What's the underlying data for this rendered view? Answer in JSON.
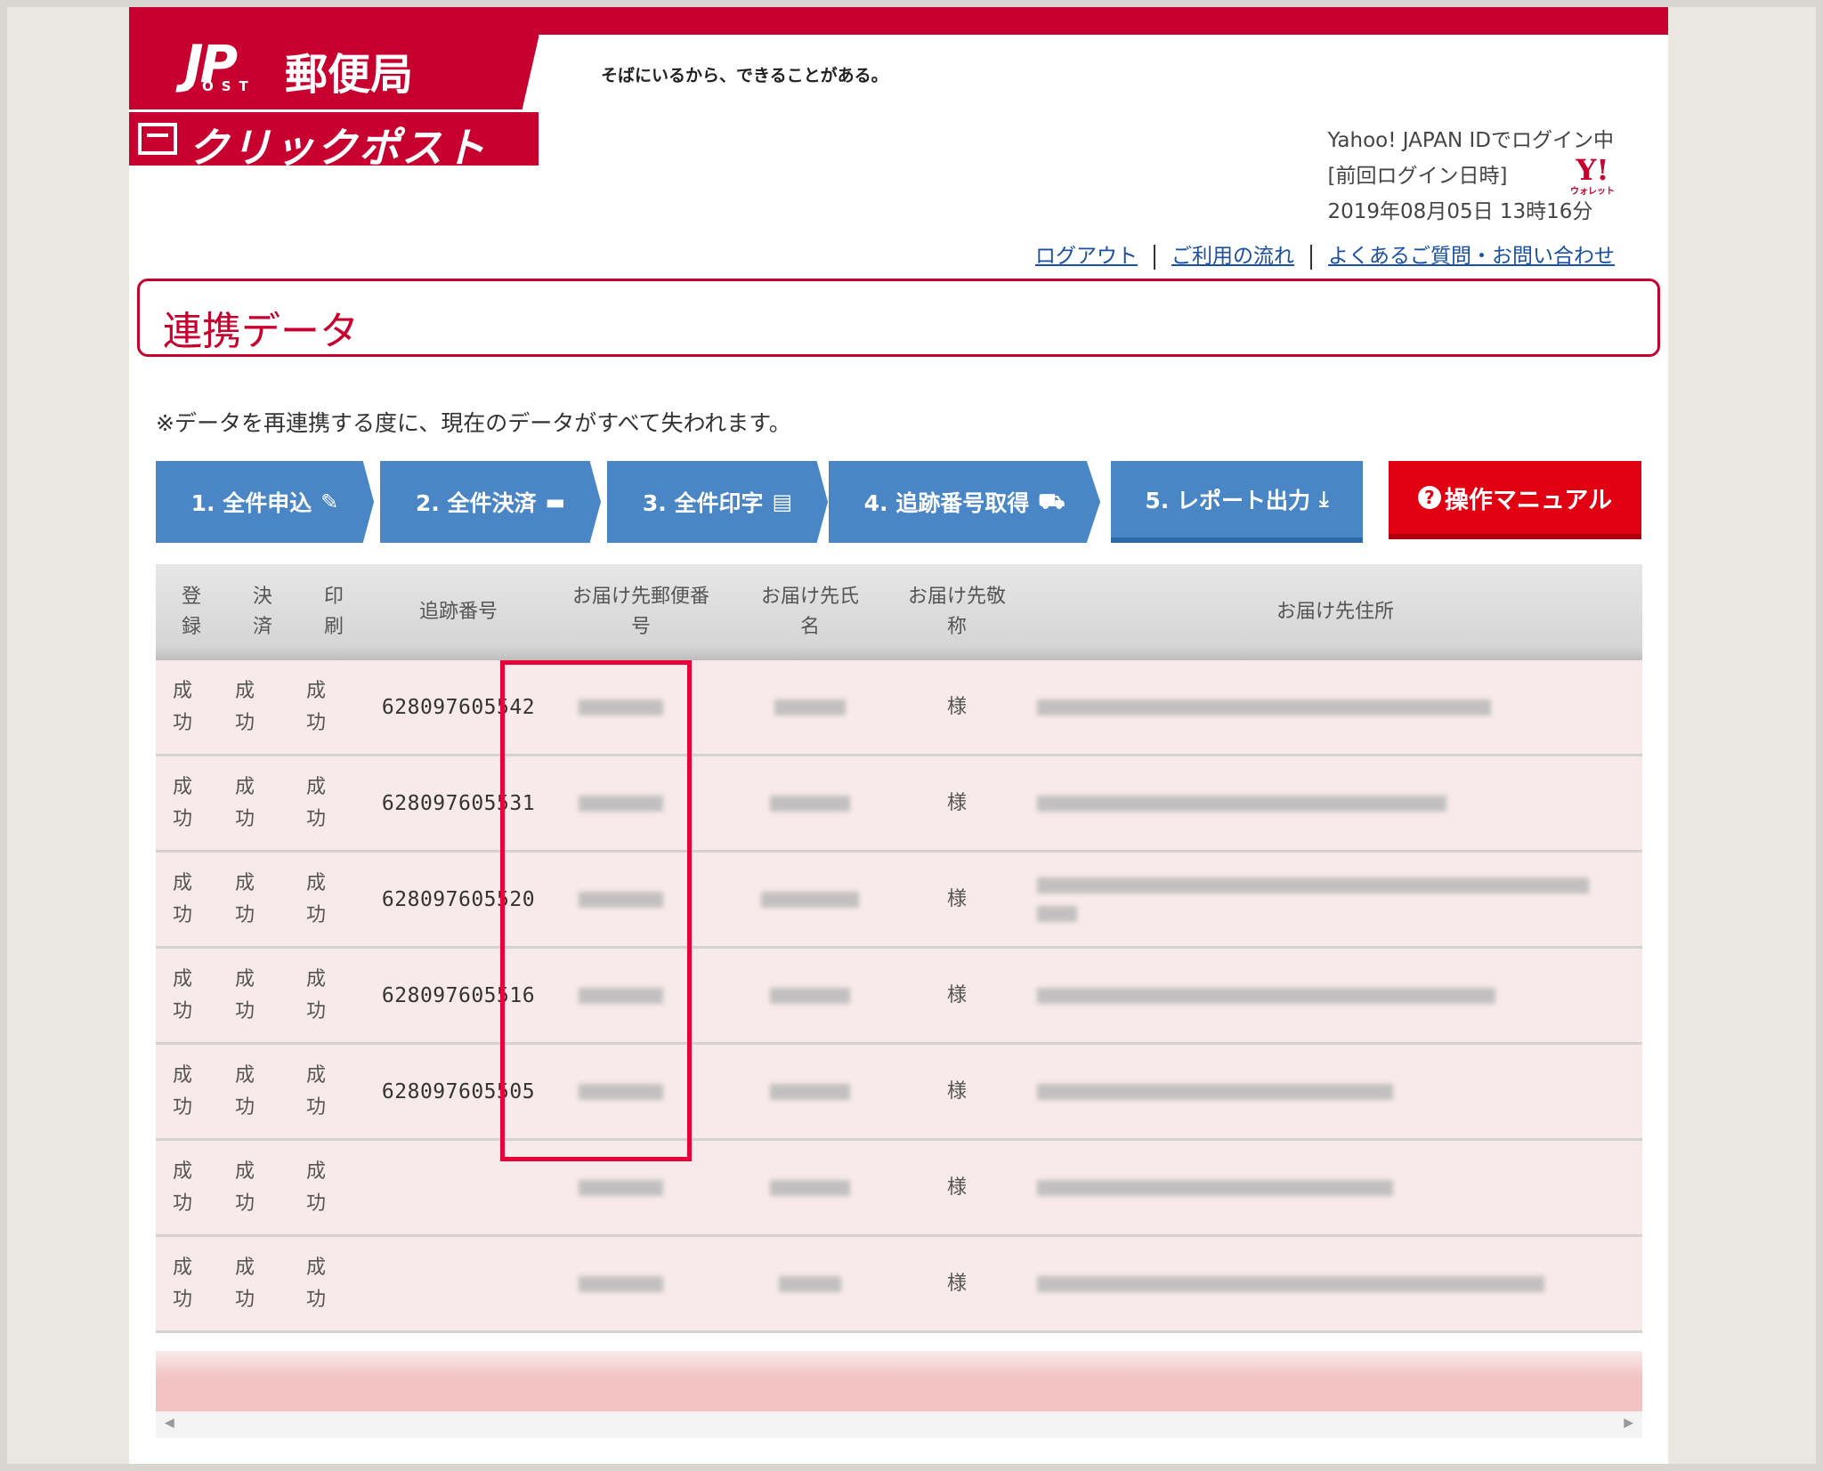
{
  "header": {
    "brand_mark": "JP",
    "brand_post": "POST",
    "brand_name": "郵便局",
    "tagline": "そばにいるから、できることがある。",
    "service_name": "クリックポスト",
    "login_status": "Yahoo! JAPAN IDでログイン中",
    "last_login_label": "[前回ログイン日時]",
    "last_login_value": "2019年08月05日 13時16分",
    "wallet_logo_text": "Y!",
    "wallet_logo_sub": "ウォレット",
    "links": [
      "ログアウト",
      "ご利用の流れ",
      "よくあるご質問・お問い合わせ"
    ]
  },
  "page": {
    "title": "連携データ",
    "note": "※データを再連携する度に、現在のデータがすべて失われます。"
  },
  "steps": [
    {
      "label": "1. 全件申込",
      "icon": "pencil-icon",
      "glyph": "✎"
    },
    {
      "label": "2. 全件決済",
      "icon": "credit-card-icon",
      "glyph": "▬"
    },
    {
      "label": "3. 全件印字",
      "icon": "pdf-icon",
      "glyph": "▤"
    },
    {
      "label": "4. 追跡番号取得",
      "icon": "truck-icon",
      "glyph": "⛟"
    },
    {
      "label": "5. レポート出力",
      "icon": "download-icon",
      "glyph": "⤓"
    }
  ],
  "manual_button": {
    "label": "操作マニュアル",
    "icon": "question-circle-icon",
    "glyph": "?"
  },
  "table": {
    "headers": {
      "registered": "登\n録",
      "settled": "決\n済",
      "printed": "印\n刷",
      "tracking": "追跡番号",
      "postal": "お届け先郵便番\n号",
      "name": "お届け先氏\n名",
      "honorific": "お届け先敬\n称",
      "address": "お届け先住所"
    },
    "rows": [
      {
        "registered": "成\n功",
        "settled": "成\n功",
        "printed": "成\n功",
        "tracking": "628097605542",
        "honorific": "様"
      },
      {
        "registered": "成\n功",
        "settled": "成\n功",
        "printed": "成\n功",
        "tracking": "628097605531",
        "honorific": "様"
      },
      {
        "registered": "成\n功",
        "settled": "成\n功",
        "printed": "成\n功",
        "tracking": "628097605520",
        "honorific": "様"
      },
      {
        "registered": "成\n功",
        "settled": "成\n功",
        "printed": "成\n功",
        "tracking": "628097605516",
        "honorific": "様"
      },
      {
        "registered": "成\n功",
        "settled": "成\n功",
        "printed": "成\n功",
        "tracking": "628097605505",
        "honorific": "様"
      },
      {
        "registered": "成\n功",
        "settled": "成\n功",
        "printed": "成\n功",
        "tracking": "",
        "honorific": "様"
      },
      {
        "registered": "成\n功",
        "settled": "成\n功",
        "printed": "成\n功",
        "tracking": "",
        "honorific": "様"
      }
    ]
  },
  "colors": {
    "brand_red": "#c8002f",
    "step_blue": "#4a86c5",
    "manual_red": "#e00012",
    "highlight": "#e8003a",
    "row_bg": "#f8eaea"
  }
}
